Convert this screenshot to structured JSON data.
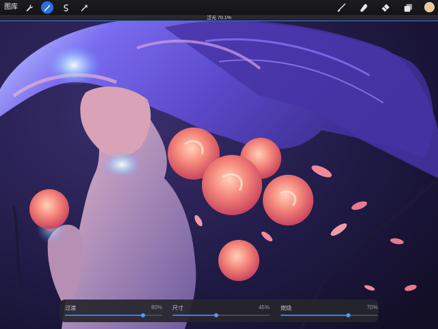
{
  "toolbar": {
    "gallery_label": "图库",
    "left_icons": [
      "wrench-icon",
      "magic-wand-icon",
      "selection-icon",
      "transform-arrow-icon"
    ],
    "active_left_icon": "magic-wand-icon",
    "right_icons": [
      "brush-icon",
      "smudge-icon",
      "eraser-icon",
      "layers-icon"
    ],
    "current_color": "#f1c791"
  },
  "status": {
    "text": "泛光 70.1%"
  },
  "adjustments": {
    "sliders": [
      {
        "label": "过渡",
        "value_text": "80%",
        "value": 0.8
      },
      {
        "label": "尺寸",
        "value_text": "45%",
        "value": 0.45
      },
      {
        "label": "燃烧",
        "value_text": "70%",
        "value": 0.7
      }
    ]
  },
  "colors": {
    "accent": "#3b7cf2",
    "toolbar_bg": "#1c1c1f",
    "panel_bg": "#26262c"
  }
}
